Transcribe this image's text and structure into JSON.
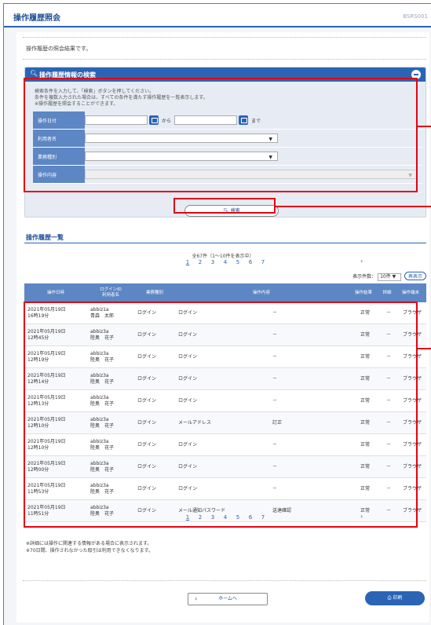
{
  "header": {
    "title": "操作履歴照会",
    "screen_code": "BSRS001"
  },
  "intro": "操作履歴の照会結果です。",
  "search": {
    "title": "操作履歴情報の検索",
    "instructions": [
      "検索条件を入力して、「検索」ボタンを押してください。",
      "条件を複数入力された場合は、すべての条件を満たす操作履歴を一覧表示します。",
      "※操作履歴を照会することができます。"
    ],
    "fields": {
      "date_label": "操作日付",
      "date_from_word": "から",
      "date_to_word": "まで",
      "user_label": "利用者名",
      "business_label": "業務種別",
      "operation_label": "操作内容"
    },
    "button_label": "検索"
  },
  "list": {
    "title": "操作履歴一覧",
    "summary": "全67件（1～10件を表示中）",
    "pages": [
      "1",
      "2",
      "3",
      "4",
      "5",
      "6",
      "7"
    ],
    "next": "›",
    "per_page_label": "表示件数：",
    "per_page_value": "10件",
    "redisplay_label": "再表示",
    "columns": [
      "操作日時",
      "ログインID\n利用者名",
      "業務種別",
      "操作内容",
      "",
      "操作結果",
      "詳細",
      "操作端末"
    ],
    "rows": [
      {
        "datetime": "2021年05月19日\n16時19分",
        "user": "abbiz1a\n青森　太郎",
        "business": "ログイン",
        "operation": "ログイン",
        "detail_value": "－",
        "result": "正常",
        "detail": "－",
        "terminal": "ブラウザ"
      },
      {
        "datetime": "2021年05月19日\n12時45分",
        "user": "abbiz3a\n陸奥　花子",
        "business": "ログイン",
        "operation": "ログイン",
        "detail_value": "－",
        "result": "正常",
        "detail": "－",
        "terminal": "ブラウザ"
      },
      {
        "datetime": "2021年05月19日\n12時19分",
        "user": "abbiz3a\n陸奥　花子",
        "business": "ログイン",
        "operation": "ログイン",
        "detail_value": "－",
        "result": "正常",
        "detail": "－",
        "terminal": "ブラウザ"
      },
      {
        "datetime": "2021年05月19日\n12時14分",
        "user": "abbiz3a\n陸奥　花子",
        "business": "ログイン",
        "operation": "ログイン",
        "detail_value": "－",
        "result": "正常",
        "detail": "－",
        "terminal": "ブラウザ"
      },
      {
        "datetime": "2021年05月19日\n12時13分",
        "user": "abbiz3a\n陸奥　花子",
        "business": "ログイン",
        "operation": "ログイン",
        "detail_value": "－",
        "result": "正常",
        "detail": "－",
        "terminal": "ブラウザ"
      },
      {
        "datetime": "2021年05月19日\n12時10分",
        "user": "abbiz3a\n陸奥　花子",
        "business": "ログイン",
        "operation": "メールアドレス",
        "detail_value": "訂正",
        "result": "正常",
        "detail": "－",
        "terminal": "ブラウザ"
      },
      {
        "datetime": "2021年05月19日\n12時10分",
        "user": "abbiz3a\n陸奥　花子",
        "business": "ログイン",
        "operation": "ログイン",
        "detail_value": "－",
        "result": "正常",
        "detail": "－",
        "terminal": "ブラウザ"
      },
      {
        "datetime": "2021年05月19日\n12時00分",
        "user": "abbiz3a\n陸奥　花子",
        "business": "ログイン",
        "operation": "ログイン",
        "detail_value": "－",
        "result": "正常",
        "detail": "－",
        "terminal": "ブラウザ"
      },
      {
        "datetime": "2021年05月19日\n11時53分",
        "user": "abbiz3a\n陸奥　花子",
        "business": "ログイン",
        "operation": "ログイン",
        "detail_value": "－",
        "result": "正常",
        "detail": "－",
        "terminal": "ブラウザ"
      },
      {
        "datetime": "2021年05月19日\n11時51分",
        "user": "abbiz3a\n陸奥　花子",
        "business": "ログイン",
        "operation": "メール通知パスワード",
        "detail_value": "送達確認",
        "result": "正常",
        "detail": "－",
        "terminal": "ブラウザ"
      }
    ]
  },
  "notes": [
    "※詳細には操作に関連する情報がある場合に表示されます。",
    "※70日間、操作されなかった取引は利用できなくなります。"
  ],
  "footer": {
    "home_label": "ホームへ",
    "print_label": "印刷"
  },
  "colors": {
    "accent": "#2b64b5",
    "highlight": "#e60012"
  }
}
